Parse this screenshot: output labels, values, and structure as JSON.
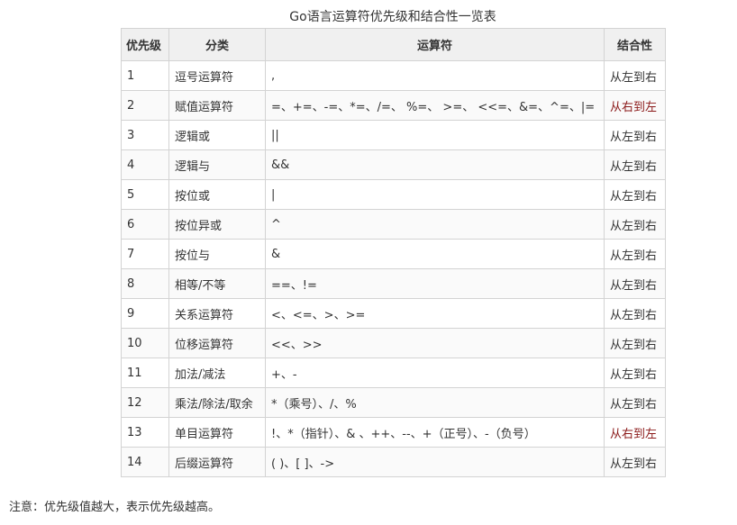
{
  "caption": "Go语言运算符优先级和结合性一览表",
  "headers": {
    "priority": "优先级",
    "category": "分类",
    "operators": "运算符",
    "associativity": "结合性"
  },
  "rows": [
    {
      "priority": "1",
      "category": "逗号运算符",
      "operators": ",",
      "associativity": "从左到右"
    },
    {
      "priority": "2",
      "category": "赋值运算符",
      "operators": "=、+=、-=、*=、/=、 %=、 >=、 <<=、&=、^=、|=",
      "associativity": "从右到左"
    },
    {
      "priority": "3",
      "category": "逻辑或",
      "operators": "||",
      "associativity": "从左到右"
    },
    {
      "priority": "4",
      "category": "逻辑与",
      "operators": "&&",
      "associativity": "从左到右"
    },
    {
      "priority": "5",
      "category": "按位或",
      "operators": "|",
      "associativity": "从左到右"
    },
    {
      "priority": "6",
      "category": "按位异或",
      "operators": "^",
      "associativity": "从左到右"
    },
    {
      "priority": "7",
      "category": "按位与",
      "operators": "&",
      "associativity": "从左到右"
    },
    {
      "priority": "8",
      "category": "相等/不等",
      "operators": "==、!=",
      "associativity": "从左到右"
    },
    {
      "priority": "9",
      "category": "关系运算符",
      "operators": "<、<=、>、>=",
      "associativity": "从左到右"
    },
    {
      "priority": "10",
      "category": "位移运算符",
      "operators": "<<、>>",
      "associativity": "从左到右"
    },
    {
      "priority": "11",
      "category": "加法/减法",
      "operators": "+、-",
      "associativity": "从左到右"
    },
    {
      "priority": "12",
      "category": "乘法/除法/取余",
      "operators": "*（乘号）、/、%",
      "associativity": "从左到右"
    },
    {
      "priority": "13",
      "category": "单目运算符",
      "operators": "!、*（指针）、& 、++、--、+（正号）、-（负号）",
      "associativity": "从右到左"
    },
    {
      "priority": "14",
      "category": "后缀运算符",
      "operators": "( )、[ ]、->",
      "associativity": "从左到右"
    }
  ],
  "note": "注意：优先级值越大，表示优先级越高。",
  "colors": {
    "right_to_left": "#8b1a1a",
    "header_bg": "#f0f0f0",
    "border": "#d3d3d3"
  }
}
